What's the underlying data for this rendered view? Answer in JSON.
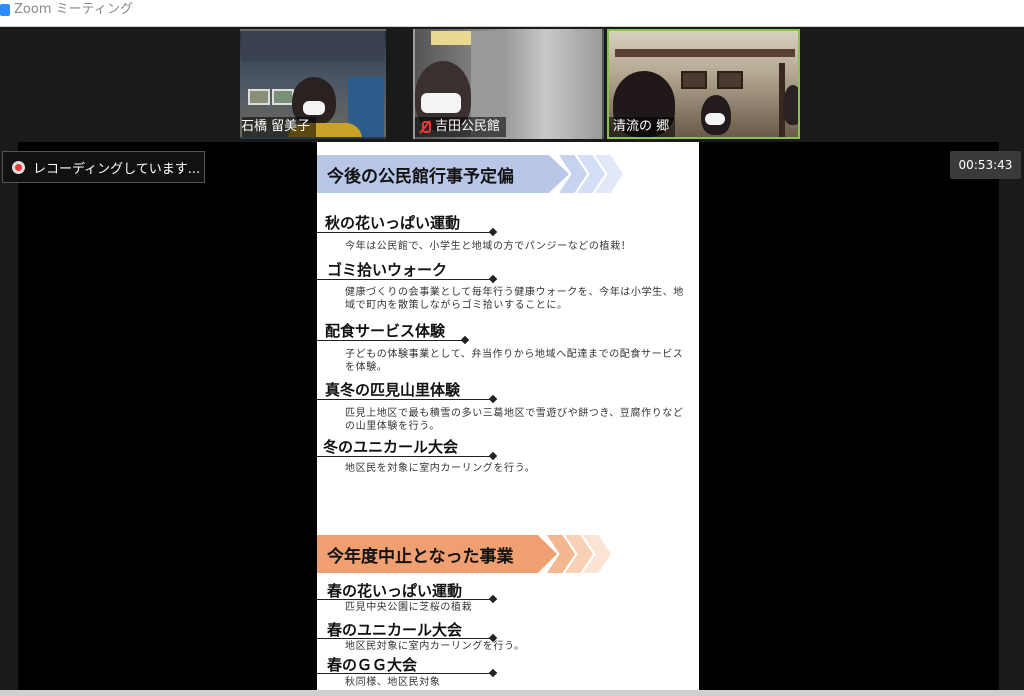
{
  "window": {
    "title": "Zoom ミーティング",
    "accent": "#2d8cff"
  },
  "participants": [
    {
      "name": "石橋 留美子",
      "muted": true
    },
    {
      "name": "吉田公民館",
      "muted": true
    },
    {
      "name": "清流の 郷",
      "muted": false,
      "active": true
    }
  ],
  "recording": {
    "label": "レコーディングしています..."
  },
  "timer": {
    "value": "00:53:43"
  },
  "slide": {
    "section1": {
      "title": "今後の公民館行事予定偏",
      "color": "#b8c6e8",
      "items": [
        {
          "heading": "秋の花いっぱい運動",
          "body": "今年は公民館で、小学生と地域の方でパンジーなどの植栽！"
        },
        {
          "heading": "ゴミ拾いウォーク",
          "body": "健康づくりの会事業として毎年行う健康ウォークを、今年は小学生、地域で町内を散策しながらゴミ拾いすることに。"
        },
        {
          "heading": "配食サービス体験",
          "body": "子どもの体験事業として、弁当作りから地域へ配達までの配食サービスを体験。"
        },
        {
          "heading": "真冬の匹見山里体験",
          "body": "匹見上地区で最も積雪の多い三葛地区で雪遊びや餅つき、豆腐作りなどの山里体験を行う。"
        },
        {
          "heading": "冬のユニカール大会",
          "body": "地区民を対象に室内カーリングを行う。"
        }
      ]
    },
    "section2": {
      "title": "今年度中止となった事業",
      "color": "#f0a070",
      "items": [
        {
          "heading": "春の花いっぱい運動",
          "body": "匹見中央公園に芝桜の植栽"
        },
        {
          "heading": "春のユニカール大会",
          "body": "地区民対象に室内カーリングを行う。"
        },
        {
          "heading": "春のＧＧ大会",
          "body": "秋同様、地区民対象"
        }
      ]
    }
  }
}
